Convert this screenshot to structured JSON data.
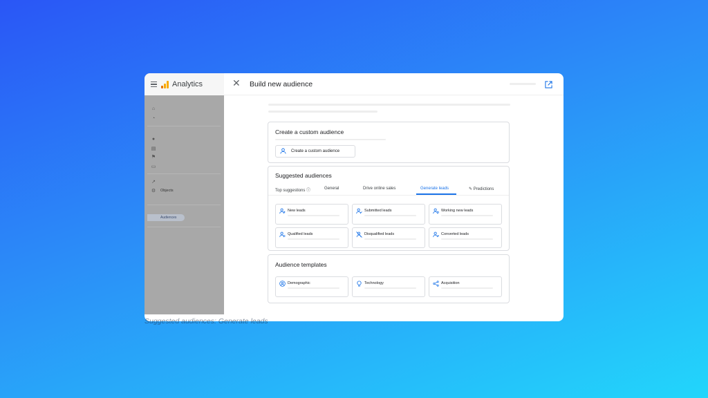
{
  "window": {
    "app_name": "Analytics",
    "panel_title": "Build new audience"
  },
  "sidebar": {
    "items": [
      {
        "icon": "home-icon",
        "label": ""
      },
      {
        "icon": "clock-icon",
        "label": ""
      },
      {
        "icon": "person-icon",
        "label": ""
      },
      {
        "icon": "table-icon",
        "label": ""
      },
      {
        "icon": "flag-icon",
        "label": ""
      },
      {
        "icon": "folder-icon",
        "label": ""
      },
      {
        "icon": "external-icon",
        "label": ""
      },
      {
        "icon": "gear-icon",
        "label": "Objects"
      }
    ],
    "active_label": "Audiences"
  },
  "custom": {
    "title": "Create a custom audience",
    "button": "Create a custom audience"
  },
  "suggested": {
    "title": "Suggested audiences",
    "tabs": [
      "Top suggestions",
      "General",
      "Drive online sales",
      "Generate leads",
      "Predictions"
    ],
    "active_tab": "Generate leads",
    "tiles": [
      "New leads",
      "Submitted leads",
      "Working new leads",
      "Qualified leads",
      "Disqualified leads",
      "Converted leads"
    ]
  },
  "templates": {
    "title": "Audience templates",
    "tiles": [
      "Demographic",
      "Technology",
      "Acquisition"
    ]
  },
  "caption": "Suggested audiences: Generate leads",
  "colors": {
    "accent": "#1a73e8",
    "logo_orange": "#f9ab00",
    "logo_dark_orange": "#e37400"
  }
}
